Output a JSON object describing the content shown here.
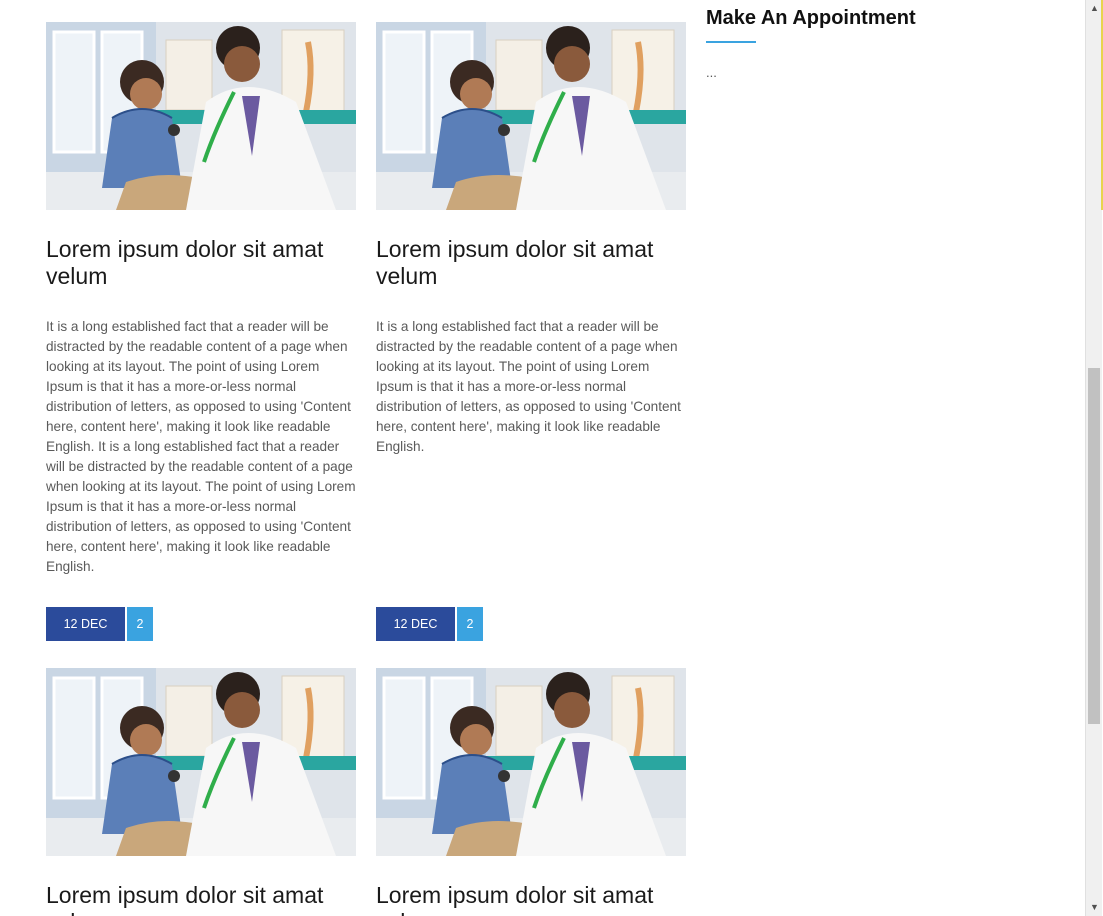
{
  "posts": [
    {
      "title": "Lorem ipsum dolor sit amat velum",
      "excerpt": "It is a long established fact that a reader will be distracted by the readable content of a page when looking at its layout. The point of using Lorem Ipsum is that it has a more-or-less normal distribution of letters, as opposed to using 'Content here, content here', making it look like readable English. It is a long established fact that a reader will be distracted by the readable content of a page when looking at its layout. The point of using Lorem Ipsum is that it has a more-or-less normal distribution of letters, as opposed to using 'Content here, content here', making it look like readable English.",
      "date": "12 DEC 12",
      "comments": "2"
    },
    {
      "title": "Lorem ipsum dolor sit amat velum",
      "excerpt": "It is a long established fact that a reader will be distracted by the readable content of a page when looking at its layout. The point of using Lorem Ipsum is that it has a more-or-less normal distribution of letters, as opposed to using 'Content here, content here', making it look like readable English.",
      "date": "12 DEC 12",
      "comments": "2"
    },
    {
      "title": "Lorem ipsum dolor sit amat velum",
      "excerpt": "",
      "date": "",
      "comments": ""
    },
    {
      "title": "Lorem ipsum dolor sit amat velum",
      "excerpt": "",
      "date": "",
      "comments": ""
    }
  ],
  "sidebar": {
    "title": "Make An Appointment",
    "body": "..."
  },
  "colors": {
    "date_badge": "#2b4b9b",
    "comment_badge": "#3aa3e0",
    "accent_underline": "#3aa3e0"
  }
}
